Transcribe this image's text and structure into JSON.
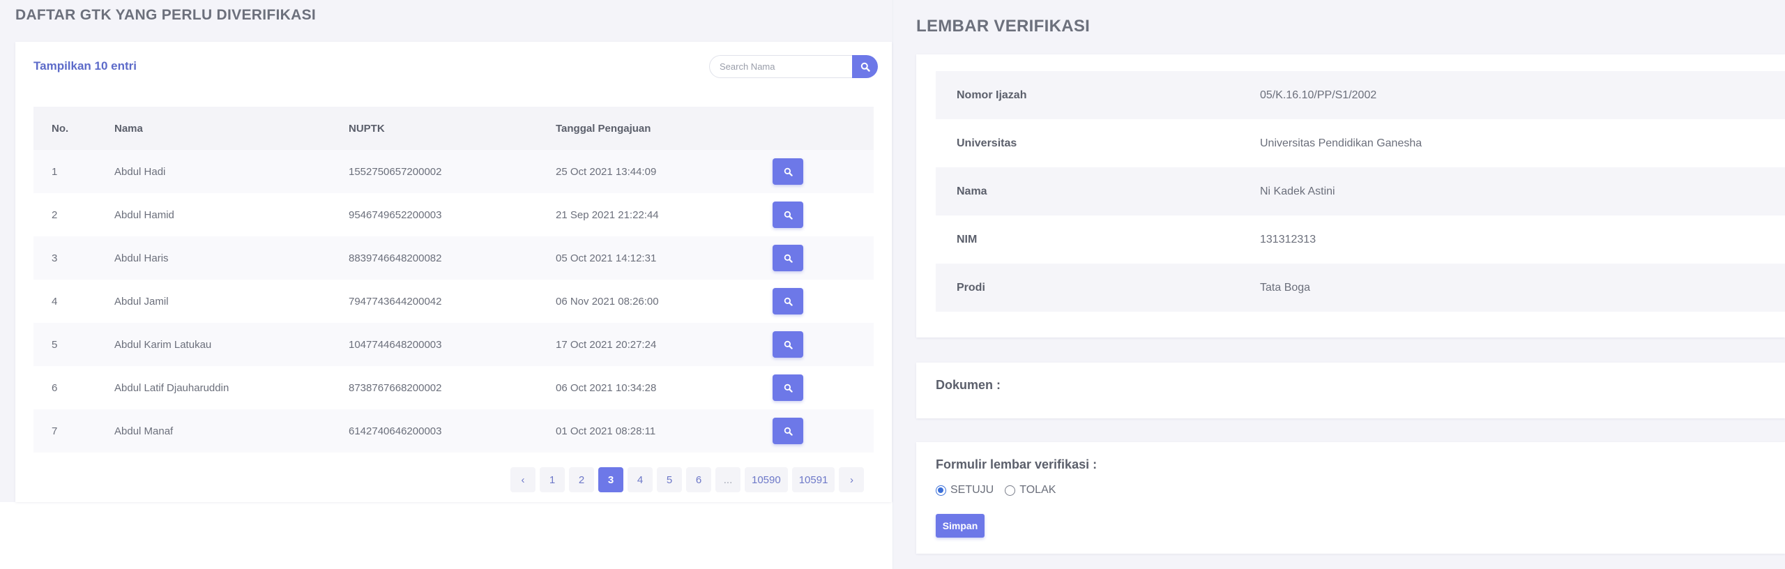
{
  "colors": {
    "accent": "#6d78e8",
    "page_bg": "#f4f4f9",
    "link": "#5d6bc9"
  },
  "left": {
    "title": "DAFTAR GTK YANG PERLU DIVERIFIKASI",
    "show_entries": "Tampilkan 10 entri",
    "search": {
      "placeholder": "Search Nama",
      "value": "",
      "icon": "search-icon"
    },
    "columns": [
      "No.",
      "Nama",
      "NUPTK",
      "Tanggal Pengajuan",
      ""
    ],
    "rows": [
      {
        "no": "1",
        "nama": "Abdul Hadi",
        "nuptk": "1552750657200002",
        "tanggal": "25 Oct 2021 13:44:09"
      },
      {
        "no": "2",
        "nama": "Abdul Hamid",
        "nuptk": "9546749652200003",
        "tanggal": "21 Sep 2021 21:22:44"
      },
      {
        "no": "3",
        "nama": "Abdul Haris",
        "nuptk": "8839746648200082",
        "tanggal": "05 Oct 2021 14:12:31"
      },
      {
        "no": "4",
        "nama": "Abdul Jamil",
        "nuptk": "7947743644200042",
        "tanggal": "06 Nov 2021 08:26:00"
      },
      {
        "no": "5",
        "nama": "Abdul Karim Latukau",
        "nuptk": "1047744648200003",
        "tanggal": "17 Oct 2021 20:27:24"
      },
      {
        "no": "6",
        "nama": "Abdul Latif Djauharuddin",
        "nuptk": "8738767668200002",
        "tanggal": "06 Oct 2021 10:34:28"
      },
      {
        "no": "7",
        "nama": "Abdul Manaf",
        "nuptk": "6142740646200003",
        "tanggal": "01 Oct 2021 08:28:11"
      }
    ],
    "pagination": {
      "prev": "‹",
      "pages": [
        "1",
        "2",
        "3",
        "4",
        "5",
        "6",
        "...",
        "10590",
        "10591"
      ],
      "active": "3",
      "next": "›"
    }
  },
  "right": {
    "title": "LEMBAR VERIFIKASI",
    "info": [
      {
        "label": "Nomor Ijazah",
        "value": "05/K.16.10/PP/S1/2002"
      },
      {
        "label": "Universitas",
        "value": "Universitas Pendidikan Ganesha"
      },
      {
        "label": "Nama",
        "value": "Ni Kadek Astini"
      },
      {
        "label": "NIM",
        "value": "131312313"
      },
      {
        "label": "Prodi",
        "value": "Tata Boga"
      }
    ],
    "dokumen_label": "Dokumen :",
    "form": {
      "title": "Formulir lembar verifikasi :",
      "options": [
        "SETUJU",
        "TOLAK"
      ],
      "selected": "SETUJU",
      "save_label": "Simpan"
    }
  }
}
